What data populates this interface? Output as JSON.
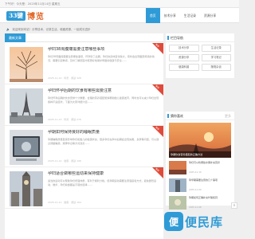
{
  "topbar": {
    "text": "下午好！今天是：2025年11月14日 星期五"
  },
  "logo": {
    "box_text": "33键",
    "text": "博览"
  },
  "nav": {
    "items": [
      {
        "label": "首页",
        "active": true
      },
      {
        "label": "技术分享",
        "active": false
      },
      {
        "label": "生活记录",
        "active": false
      },
      {
        "label": "资源分享",
        "active": false
      }
    ]
  },
  "notice": {
    "icon": "volume-icon",
    "text": "欢迎来到本站！分享技术、记录生活、收藏资源、一起成长进步"
  },
  "main": {
    "tab_label": "最新文章",
    "articles": [
      {
        "title": "孕妇38周腹痛需要注意哪些事项",
        "desc": "孕妇38周腹痛需要注意哪些事项，怀孕到了后期，孕妇的身体变化较大，有时会出现腹部疼痛的情况，需要引起重视，及时了解原因才能更好地保护母婴的健康与安全……",
        "meta": "2025-11-14 · 科普 · 阅读 328",
        "ribbon": "推荐"
      },
      {
        "title": "孕妇怀孕后期的饮食有哪些需要注意",
        "desc": "孕妇怀孕后期的饮食安排十分重要，合理的营养搭配能够帮助胎儿健康发育，同时也可以减少孕妇出现各种不适症状，下面为大家详细介绍……",
        "meta": "2025-11-13 · 科普 · 阅读 276",
        "ribbon": "推荐"
      },
      {
        "title": "孕期如何保持良好的睡眠质量",
        "desc": "孕期睡眠质量直接影响孕妇和胎儿的健康状态，很多孕妇在孕中后期会出现失眠、多梦等问题，可以通过调整睡姿、规律作息等方式改善……",
        "meta": "2025-11-12 · 健康 · 阅读 198",
        "ribbon": "推荐"
      },
      {
        "title": "孕妇适合做哪些运动来保持健康",
        "desc": "适当的运动可以帮助孕妇增强体质，有利于顺利分娩，但孕期运动需要注意强度和方式，避免剧烈运动，散步、孕妇瑜伽都是不错的选择……",
        "meta": "2025-11-11 · 健康 · 阅读 164",
        "ribbon": "推荐"
      }
    ]
  },
  "sidebar": {
    "categories_title": "栏目导航",
    "categories": [
      "技术分享",
      "生活记录",
      "资源分享",
      "学习笔记",
      "健康科普",
      "随笔杂谈"
    ],
    "hot_title": "猜你喜欢",
    "hot_more": "更多",
    "hot_big_caption": "孕期饮食营养搭配的正确方法",
    "hot_items": [
      {
        "title": "孕妇可以吃哪些水果补充营养",
        "date": "2025-11-10"
      },
      {
        "title": "孕早期需要注意的几个事项",
        "date": "2025-11-09"
      },
      {
        "title": "孕期如何正确补充叶酸和钙",
        "date": "2025-11-08"
      },
      {
        "title": "准妈妈孕期护肤有哪些讲究",
        "date": "2025-11-07"
      }
    ]
  },
  "watermark": {
    "icon_text": "便",
    "text": "便民库"
  },
  "totop": {
    "label": "∧"
  },
  "colors": {
    "accent": "#2f9bd6",
    "ribbon": "#e04a3a",
    "logo_orange": "#e46a2b"
  }
}
